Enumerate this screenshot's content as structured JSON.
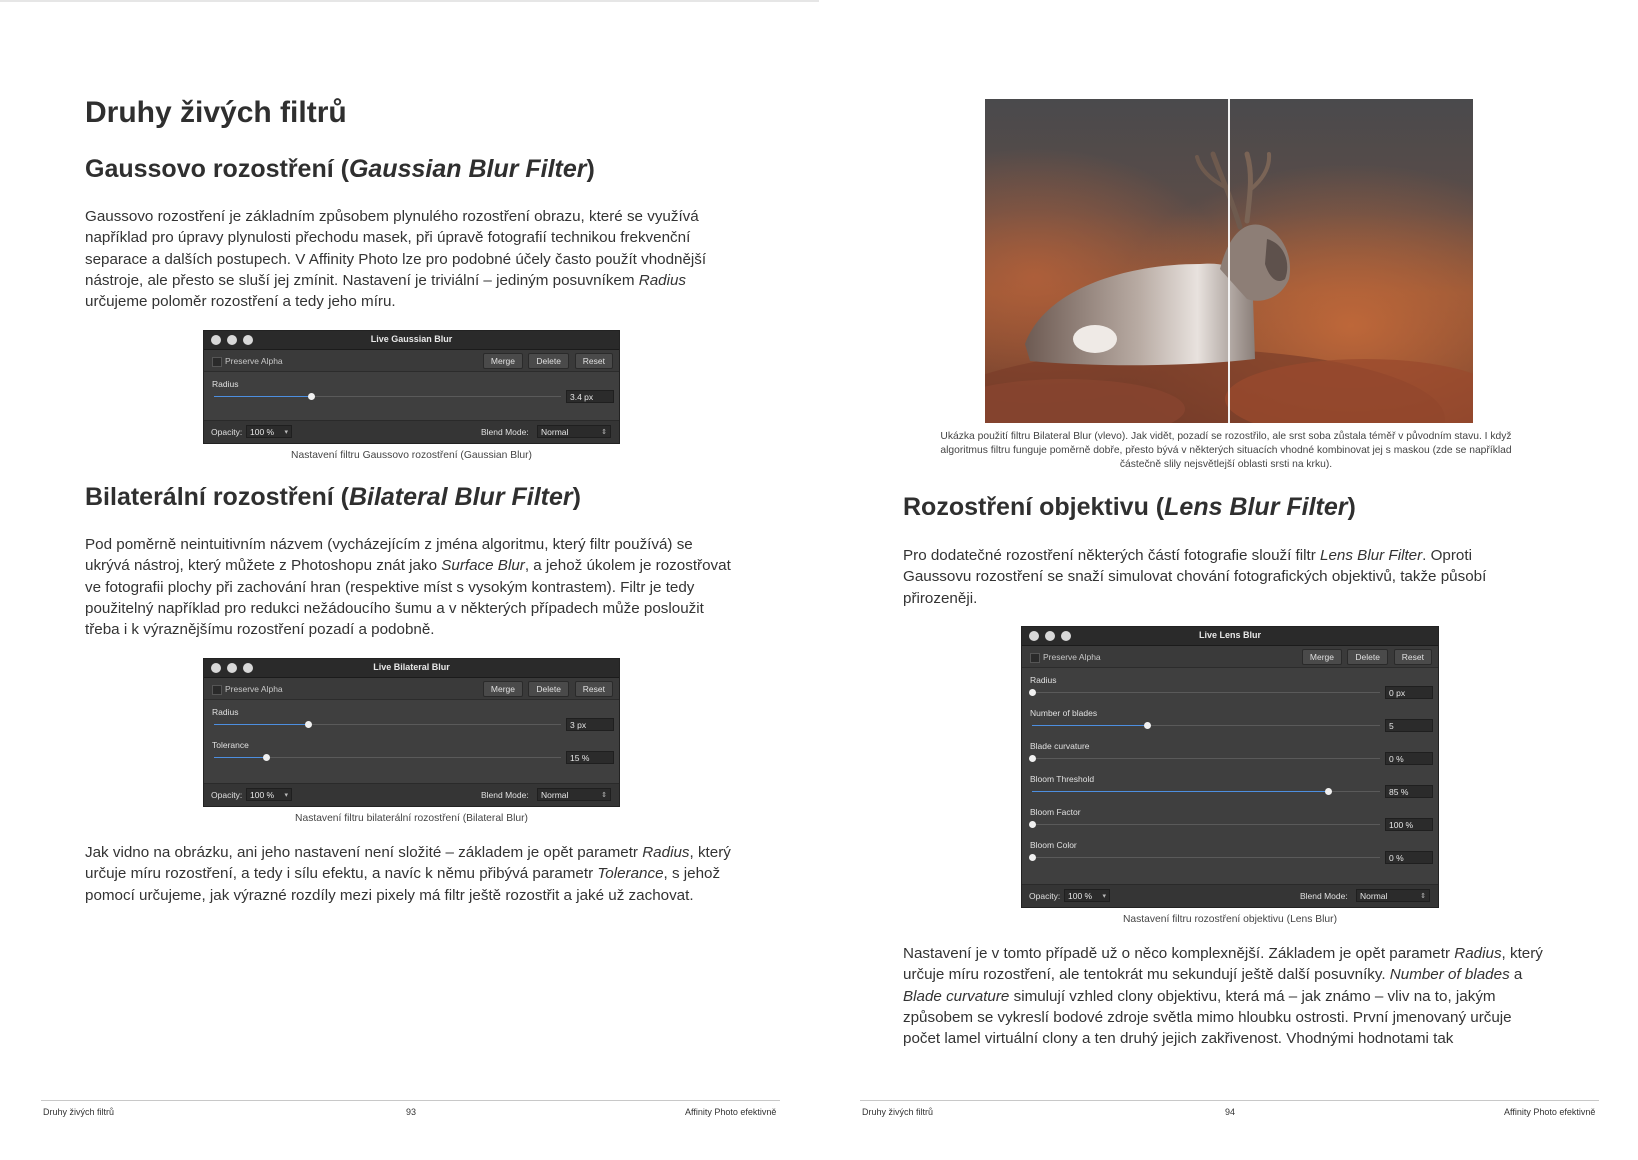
{
  "left_page": {
    "title": "Druhy živých filtrů",
    "gauss": {
      "heading_prefix": "Gaussovo rozostření (",
      "heading_italic": "Gaussian Blur Filter",
      "heading_suffix": ")",
      "para1_a": "Gaussovo rozostření je základním způsobem plynulého rozostření obrazu, které se využívá například pro úpravy plynulosti přechodu masek, při úpravě fotografií technikou frekvenční separace a dalších postupech. V Affinity Photo lze pro podobné účely často použít vhodnější nástroje, ale přesto se sluší jej zmínit. Nastavení je triviální – jediným posuvníkem ",
      "para1_i": "Radius",
      "para1_b": " určujeme poloměr rozostření a tedy jeho míru.",
      "dialog": {
        "title": "Live Gaussian Blur",
        "preserve_alpha": "Preserve Alpha",
        "merge": "Merge",
        "delete": "Delete",
        "reset": "Reset",
        "params": [
          {
            "label": "Radius",
            "value": "3.4 px",
            "level": 0.28
          }
        ],
        "opacity_label": "Opacity:",
        "opacity_value": "100 %",
        "blend_label": "Blend Mode:",
        "blend_value": "Normal"
      },
      "caption": "Nastavení filtru Gaussovo rozostření (Gaussian Blur)"
    },
    "bilateral": {
      "heading_prefix": "Bilaterální rozostření (",
      "heading_italic": "Bilateral Blur Filter",
      "heading_suffix": ")",
      "para_a": "Pod poměrně neintuitivním názvem (vycházejícím z jména algoritmu, který filtr používá) se ukrývá nástroj, který můžete z Photoshopu znát jako ",
      "para_i": "Surface Blur",
      "para_b": ", a jehož úkolem je rozostřovat ve fotografii plochy při zachování hran (respektive míst s vysokým kontrastem). Filtr je tedy použitelný například pro redukci nežádoucího šumu a v některých případech může posloužit třeba i k výraznějšímu rozostření pozadí a podobně.",
      "dialog": {
        "title": "Live Bilateral Blur",
        "preserve_alpha": "Preserve Alpha",
        "merge": "Merge",
        "delete": "Delete",
        "reset": "Reset",
        "params": [
          {
            "label": "Radius",
            "value": "3 px",
            "level": 0.27
          },
          {
            "label": "Tolerance",
            "value": "15 %",
            "level": 0.15
          }
        ],
        "opacity_label": "Opacity:",
        "opacity_value": "100 %",
        "blend_label": "Blend Mode:",
        "blend_value": "Normal"
      },
      "caption": "Nastavení filtru bilaterální rozostření (Bilateral Blur)",
      "para2_a": "Jak vidno na obrázku, ani jeho nastavení není složité – základem je opět parametr ",
      "para2_i1": "Radius",
      "para2_b": ", který určuje míru rozostření, a tedy i sílu efektu, a navíc k němu přibývá parametr ",
      "para2_i2": "Tolerance",
      "para2_c": ", s jehož pomocí určujeme, jak výrazné rozdíly mezi pixely má filtr ještě rozostřit a jaké už zachovat."
    },
    "footer": {
      "left": "Druhy živých filtrů",
      "page": "93",
      "right": "Affinity Photo efektivně"
    }
  },
  "right_page": {
    "photo_caption": "Ukázka použití filtru Bilateral Blur (vlevo). Jak vidět, pozadí se rozostřilo, ale srst soba zůstala téměř v původním stavu. I když algoritmus filtru funguje poměrně dobře, přesto bývá v některých situacích vhodné kombinovat jej s maskou (zde se například částečně slily nejsvětlejší oblasti srsti na krku).",
    "lens": {
      "heading_prefix": "Rozostření objektivu (",
      "heading_italic": "Lens Blur Filter",
      "heading_suffix": ")",
      "para_a": "Pro dodatečné rozostření některých částí fotografie slouží filtr ",
      "para_i": "Lens Blur Filter",
      "para_b": ". Oproti Gaussovu rozostření se snaží simulovat chování fotografických objektivů, takže působí přirozeněji.",
      "dialog": {
        "title": "Live Lens Blur",
        "preserve_alpha": "Preserve Alpha",
        "merge": "Merge",
        "delete": "Delete",
        "reset": "Reset",
        "params": [
          {
            "label": "Radius",
            "value": "0 px",
            "level": 0.0
          },
          {
            "label": "Number of blades",
            "value": "5",
            "level": 0.33
          },
          {
            "label": "Blade curvature",
            "value": "0 %",
            "level": 0.0
          },
          {
            "label": "Bloom Threshold",
            "value": "85 %",
            "level": 0.85
          },
          {
            "label": "Bloom Factor",
            "value": "100 %",
            "level": 0.0
          },
          {
            "label": "Bloom Color",
            "value": "0 %",
            "level": 0.0
          }
        ],
        "opacity_label": "Opacity:",
        "opacity_value": "100 %",
        "blend_label": "Blend Mode:",
        "blend_value": "Normal"
      },
      "caption": "Nastavení filtru rozostření objektivu (Lens Blur)",
      "para2_a": "Nastavení je v tomto případě už o něco komplexnější. Základem je opět parametr ",
      "para2_i1": "Radius",
      "para2_b": ", který určuje míru rozostření, ale tentokrát mu sekundují ještě další posuvníky. ",
      "para2_i2": "Number of blades",
      "para2_c": " a ",
      "para2_i3": "Blade curvature",
      "para2_d": " simulují vzhled clony objektivu, která má – jak známo – vliv na to, jakým způsobem se vykreslí bodové zdroje světla mimo hloubku ostrosti. První jmenovaný určuje počet lamel virtuální clony a ten druhý jejich zakřivenost. Vhodnými hodnotami tak"
    },
    "footer": {
      "left": "Druhy živých filtrů",
      "page": "94",
      "right": "Affinity Photo efektivně"
    }
  },
  "colors": {
    "slider_fill": "#4d8fe0",
    "dialog_bg": "#3f3f3f",
    "titlebar": "#2a2a2a"
  }
}
